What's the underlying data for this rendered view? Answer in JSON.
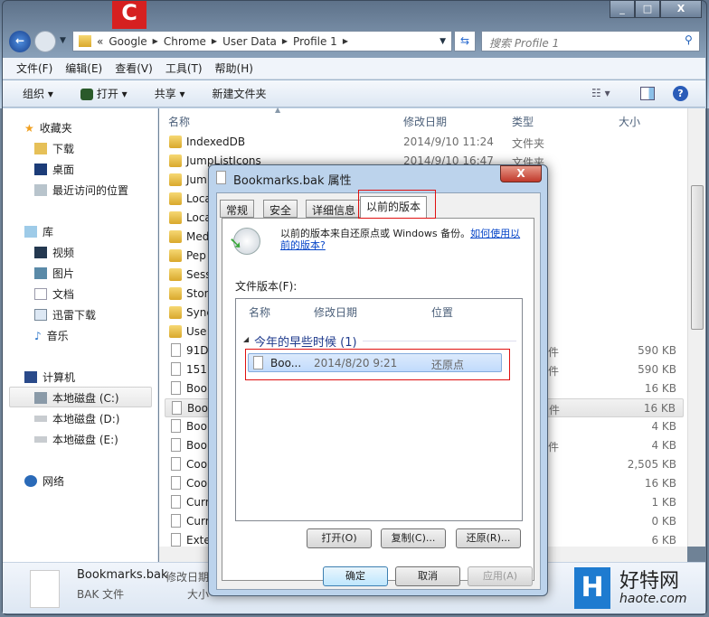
{
  "window": {
    "controls": [
      "_",
      "□",
      "X"
    ]
  },
  "address": {
    "crumbs": [
      "«",
      "Google",
      "Chrome",
      "User Data",
      "Profile 1"
    ],
    "search_placeholder": "搜索 Profile 1"
  },
  "menu": [
    "文件(F)",
    "编辑(E)",
    "查看(V)",
    "工具(T)",
    "帮助(H)"
  ],
  "toolbar": {
    "organize": "组织 ▾",
    "open": "打开 ▾",
    "share": "共享 ▾",
    "new_folder": "新建文件夹"
  },
  "nav": {
    "favorites": "收藏夹",
    "downloads": "下载",
    "desktop": "桌面",
    "recent": "最近访问的位置",
    "libraries": "库",
    "videos": "视频",
    "pictures": "图片",
    "documents": "文档",
    "thunder": "迅雷下载",
    "music": "音乐",
    "computer": "计算机",
    "c": "本地磁盘 (C:)",
    "d": "本地磁盘 (D:)",
    "e": "本地磁盘 (E:)",
    "network": "网络"
  },
  "columns": {
    "name": "名称",
    "date": "修改日期",
    "type": "类型",
    "size": "大小"
  },
  "files": [
    {
      "name": "IndexedDB",
      "date": "2014/9/10 11:24",
      "type": "文件夹",
      "size": "",
      "folder": true
    },
    {
      "name": "JumpListIcons",
      "date": "2014/9/10 16:47",
      "type": "文件夹",
      "size": "",
      "folder": true
    },
    {
      "name": "Jum",
      "folder": true
    },
    {
      "name": "Loca",
      "folder": true
    },
    {
      "name": "Loca",
      "folder": true
    },
    {
      "name": "Med",
      "folder": true
    },
    {
      "name": "Pep",
      "folder": true
    },
    {
      "name": "Sess",
      "folder": true
    },
    {
      "name": "Stor",
      "folder": true
    },
    {
      "name": "Sync",
      "folder": true
    },
    {
      "name": "Use",
      "folder": true
    },
    {
      "name": "91D",
      "type": "件",
      "size": "590 KB"
    },
    {
      "name": "151",
      "type": "件",
      "size": "590 KB"
    },
    {
      "name": "Boo",
      "size": "16 KB"
    },
    {
      "name": "Boo",
      "type": "件",
      "size": "16 KB",
      "selected": true
    },
    {
      "name": "Boo",
      "size": "4 KB"
    },
    {
      "name": "Boo",
      "type": "件",
      "size": "4 KB"
    },
    {
      "name": "Coo",
      "size": "2,505 KB"
    },
    {
      "name": "Coo",
      "size": "16 KB"
    },
    {
      "name": "Curr",
      "size": "1 KB"
    },
    {
      "name": "Curr",
      "size": "0 KB"
    },
    {
      "name": "Exte",
      "size": "6 KB"
    }
  ],
  "details": {
    "filename": "Bookmarks.bak",
    "type": "BAK 文件",
    "date_label": "修改日期",
    "size_label": "大小"
  },
  "dialog": {
    "title": "Bookmarks.bak 属性",
    "close": "X",
    "tabs": [
      "常规",
      "安全",
      "详细信息",
      "以前的版本"
    ],
    "info": "以前的版本来自还原点或 Windows 备份。",
    "link": "如何使用以前的版本?",
    "list_label": "文件版本(F):",
    "cols": [
      "名称",
      "修改日期",
      "位置"
    ],
    "group": "今年的早些时候 (1)",
    "version": {
      "name": "Boo...",
      "date": "2014/8/20 9:21",
      "location": "还原点"
    },
    "open": "打开(O)",
    "copy": "复制(C)...",
    "restore": "还原(R)...",
    "ok": "确定",
    "cancel": "取消",
    "apply": "应用(A)"
  },
  "watermark": {
    "brand": "好特网",
    "url": "haote.com"
  }
}
